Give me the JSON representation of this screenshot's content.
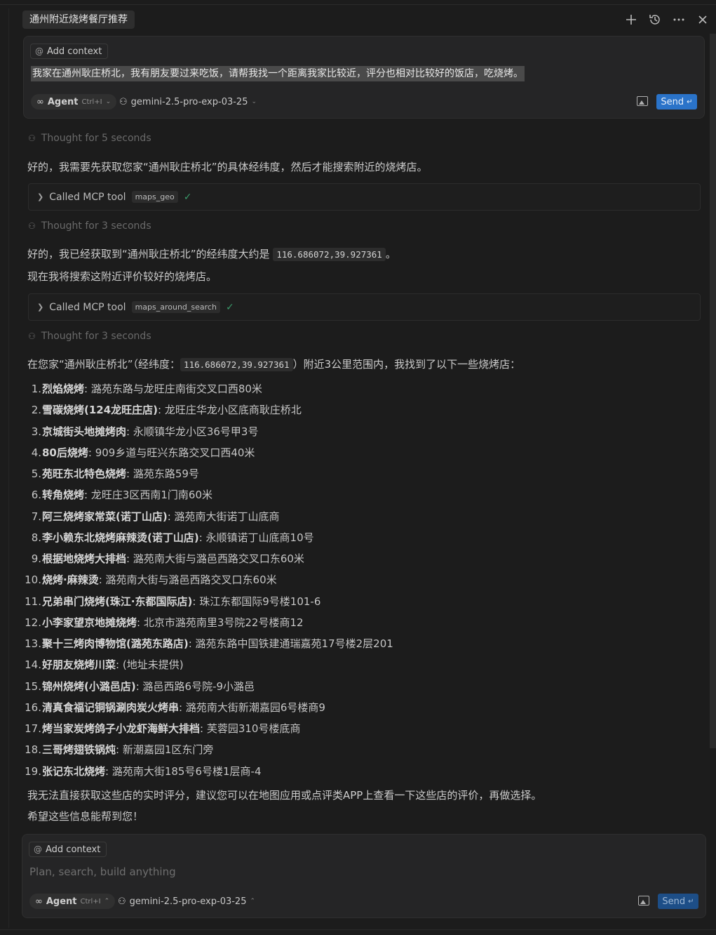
{
  "header": {
    "title": "通州附近烧烤餐厅推荐",
    "icons": [
      "plus-icon",
      "history-icon",
      "more-icon",
      "close-icon"
    ]
  },
  "top_composer": {
    "add_context": "Add context",
    "query": "我家在通州耿庄桥北，我有朋友要过来吃饭，请帮我找一个距离我家比较近，评分也相对比较好的饭店，吃烧烤。",
    "agent_label": "Agent",
    "agent_shortcut": "Ctrl+I",
    "model": "gemini-2.5-pro-exp-03-25",
    "send": "Send"
  },
  "conversation": {
    "thought1": "Thought for 5 seconds",
    "msg1": "好的，我需要先获取您家“通州耿庄桥北”的具体经纬度，然后才能搜索附近的烧烤店。",
    "tool1": {
      "label": "Called MCP tool",
      "name": "maps_geo"
    },
    "thought2": "Thought for 3 seconds",
    "msg2_prefix": "好的，我已经获取到“通州耿庄桥北”的经纬度大约是 ",
    "msg2_code": "116.686072,39.927361",
    "msg2_suffix": "。",
    "msg3": "现在我将搜索这附近评价较好的烧烤店。",
    "tool2": {
      "label": "Called MCP tool",
      "name": "maps_around_search"
    },
    "thought3": "Thought for 3 seconds",
    "intro_prefix": "在您家“通州耿庄桥北”（经纬度：",
    "intro_code": "116.686072,39.927361",
    "intro_suffix": "）附近3公里范围内，我找到了以下一些烧烤店：",
    "results": [
      {
        "num": "1.",
        "name": "烈焰烧烤",
        "addr": ": 潞苑东路与龙旺庄南街交叉口西80米"
      },
      {
        "num": "2.",
        "name": "雪碳烧烤(124龙旺庄店)",
        "addr": ": 龙旺庄华龙小区底商耿庄桥北"
      },
      {
        "num": "3.",
        "name": "京城街头地摊烤肉",
        "addr": ": 永顺镇华龙小区36号甲3号"
      },
      {
        "num": "4.",
        "name": "80后烧烤",
        "addr": ": 909乡道与旺兴东路交叉口西40米"
      },
      {
        "num": "5.",
        "name": "苑旺东北特色烧烤",
        "addr": ": 潞苑东路59号"
      },
      {
        "num": "6.",
        "name": "转角烧烤",
        "addr": ": 龙旺庄3区西南1门南60米"
      },
      {
        "num": "7.",
        "name": "阿三烧烤家常菜(诺丁山店)",
        "addr": ": 潞苑南大街诺丁山底商"
      },
      {
        "num": "8.",
        "name": "李小赖东北烧烤麻辣烫(诺丁山店)",
        "addr": ": 永顺镇诺丁山底商10号"
      },
      {
        "num": "9.",
        "name": "根据地烧烤大排档",
        "addr": ": 潞苑南大街与潞邑西路交叉口东60米"
      },
      {
        "num": "10.",
        "name": "烧烤·麻辣烫",
        "addr": ": 潞苑南大街与潞邑西路交叉口东60米"
      },
      {
        "num": "11.",
        "name": "兄弟串门烧烤(珠江·东都国际店)",
        "addr": ": 珠江东都国际9号楼101-6"
      },
      {
        "num": "12.",
        "name": "小李家望京地摊烧烤",
        "addr": ": 北京市潞苑南里3号院22号楼商12"
      },
      {
        "num": "13.",
        "name": "聚十三烤肉博物馆(潞苑东路店)",
        "addr": ": 潞苑东路中国铁建通瑞嘉苑17号楼2层201"
      },
      {
        "num": "14.",
        "name": "好朋友烧烤川菜",
        "addr": ": (地址未提供)"
      },
      {
        "num": "15.",
        "name": "锦州烧烤(小潞邑店)",
        "addr": ": 潞邑西路6号院-9小潞邑"
      },
      {
        "num": "16.",
        "name": "清真食福记铜锅涮肉炭火烤串",
        "addr": ": 潞苑南大街新潮嘉园6号楼商9"
      },
      {
        "num": "17.",
        "name": "烤当家炭烤鸽子小龙虾海鲜大排档",
        "addr": ": 芙蓉园310号楼底商"
      },
      {
        "num": "18.",
        "name": "三哥烤翅铁锅炖",
        "addr": ": 新潮嘉园1区东门旁"
      },
      {
        "num": "19.",
        "name": "张记东北烧烤",
        "addr": ": 潞苑南大街185号6号楼1层商-4"
      }
    ],
    "note1": "我无法直接获取这些店的实时评分，建议您可以在地图应用或点评类APP上查看一下这些店的评价，再做选择。",
    "note2": "希望这些信息能帮到您！"
  },
  "bottom_composer": {
    "add_context": "Add context",
    "placeholder": "Plan, search, build anything",
    "agent_label": "Agent",
    "agent_shortcut": "Ctrl+I",
    "model": "gemini-2.5-pro-exp-03-25",
    "send": "Send"
  },
  "colors": {
    "background": "#1c1c1c",
    "send_button": "#2a73c9",
    "tool_check": "#3a9a6a"
  }
}
